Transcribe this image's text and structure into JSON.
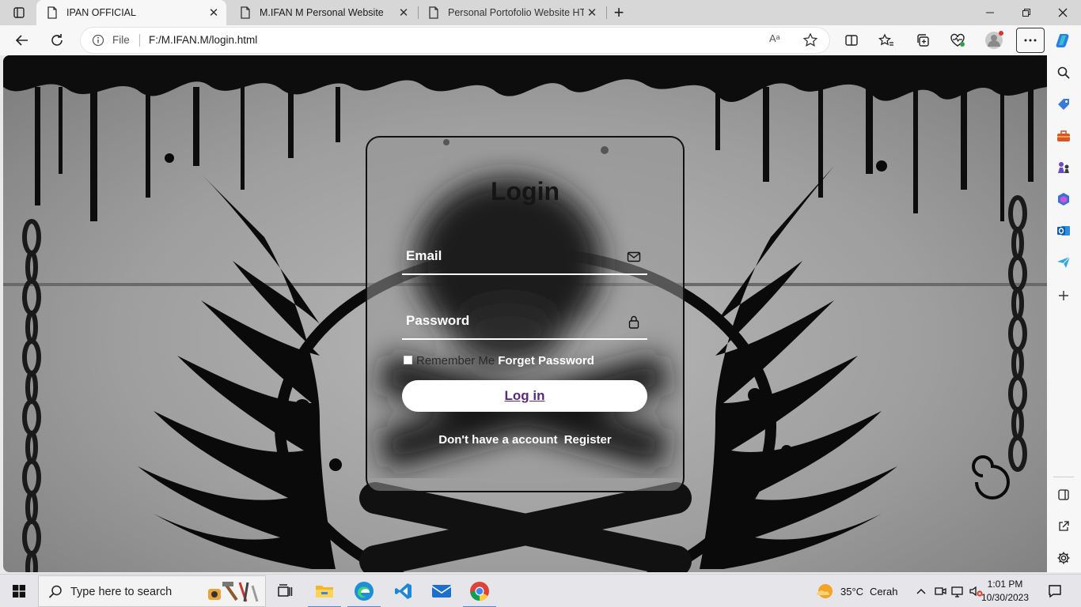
{
  "browser": {
    "tabs": [
      {
        "title": "IPAN OFFICIAL",
        "active": true
      },
      {
        "title": "M.IFAN M Personal Website",
        "active": false
      },
      {
        "title": "Personal Portofolio Website HTM",
        "active": false
      }
    ],
    "address": {
      "scheme_label": "File",
      "url": "F:/M.IFAN.M/login.html",
      "read_aloud": "Aᵃ"
    }
  },
  "login": {
    "title": "Login",
    "email_label": "Email",
    "password_label": "Password",
    "remember_label": "Remember Me",
    "forget_label": "Forget Password",
    "login_button": "Log in",
    "no_account_text": "Don't have a account",
    "register_link": "Register"
  },
  "taskbar": {
    "search_placeholder": "Type here to search",
    "weather_temp": "35°C",
    "weather_text": "Cerah",
    "time": "1:01 PM",
    "date": "10/30/2023"
  },
  "colors": {
    "button_text": "#5a2b7a",
    "accent_blue": "#4a89dc"
  }
}
